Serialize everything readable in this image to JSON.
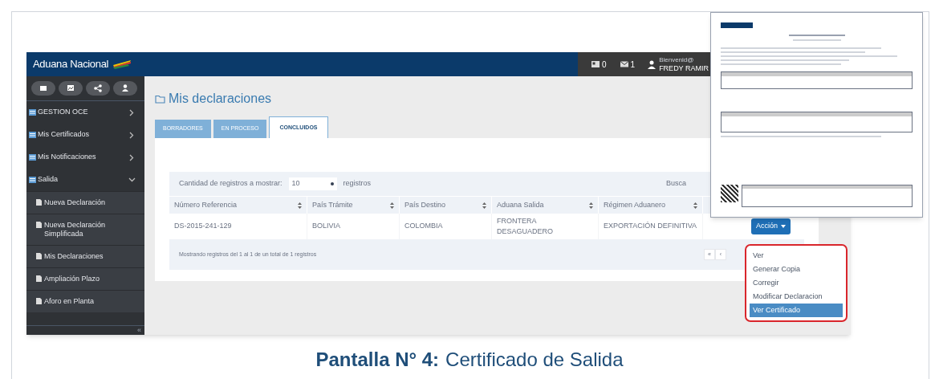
{
  "app": {
    "brand": "Aduana Nacional",
    "header": {
      "counters": [
        {
          "kind": "news",
          "count": "0"
        },
        {
          "kind": "mail",
          "count": "1"
        }
      ],
      "greeting": "Bienvenid@",
      "user": "FREDY RAMIR"
    }
  },
  "sidebar": {
    "shortcuts": [
      {
        "kind": "mail"
      },
      {
        "kind": "chart"
      },
      {
        "kind": "share"
      },
      {
        "kind": "user"
      }
    ],
    "items": [
      {
        "label": "GESTION OCE",
        "expanded": false
      },
      {
        "label": "Mis Certificados",
        "expanded": false
      },
      {
        "label": "Mis Notificaciones",
        "expanded": false
      },
      {
        "label": "Salida",
        "expanded": true,
        "children": [
          {
            "label": "Nueva Declaración"
          },
          {
            "label": "Nueva Declaración Simplificada"
          },
          {
            "label": "Mis Declaraciones"
          },
          {
            "label": "Ampliación Plazo"
          },
          {
            "label": "Aforo en Planta"
          }
        ]
      }
    ],
    "collapse": "«"
  },
  "page_title": "Mis declaraciones",
  "tabs": [
    {
      "label": "BORRADORES",
      "selected": false
    },
    {
      "label": "EN PROCESO",
      "selected": false
    },
    {
      "label": "CONCLUIDOS",
      "selected": true
    }
  ],
  "table": {
    "length_label": "Cantidad de registros a mostrar:",
    "length_value": "10",
    "length_suffix": "registros",
    "search_label": "Busca",
    "columns": [
      "Número Referencia",
      "País Trámite",
      "País Destino",
      "Aduana Salida",
      "Régimen Aduanero"
    ],
    "rows": [
      {
        "cells": [
          "DS-2015-241-129",
          "BOLIVIA",
          "COLOMBIA",
          "FRONTERA DESAGUADERO",
          "EXPORTACIÓN DEFINITIVA"
        ],
        "action": "Acción"
      }
    ],
    "info": "Mostrando registros del 1 al 1 de un total de 1 registros",
    "pagination": [
      "«",
      "‹"
    ]
  },
  "action_menu": [
    {
      "label": "Ver",
      "selected": false
    },
    {
      "label": "Generar Copia",
      "selected": false
    },
    {
      "label": "Corregir",
      "selected": false
    },
    {
      "label": "Modificar Declaracion",
      "selected": false
    },
    {
      "label": "Ver Certificado",
      "selected": true
    }
  ],
  "caption": {
    "label": "Pantalla N° 4:",
    "text": "Certificado de Salida"
  }
}
